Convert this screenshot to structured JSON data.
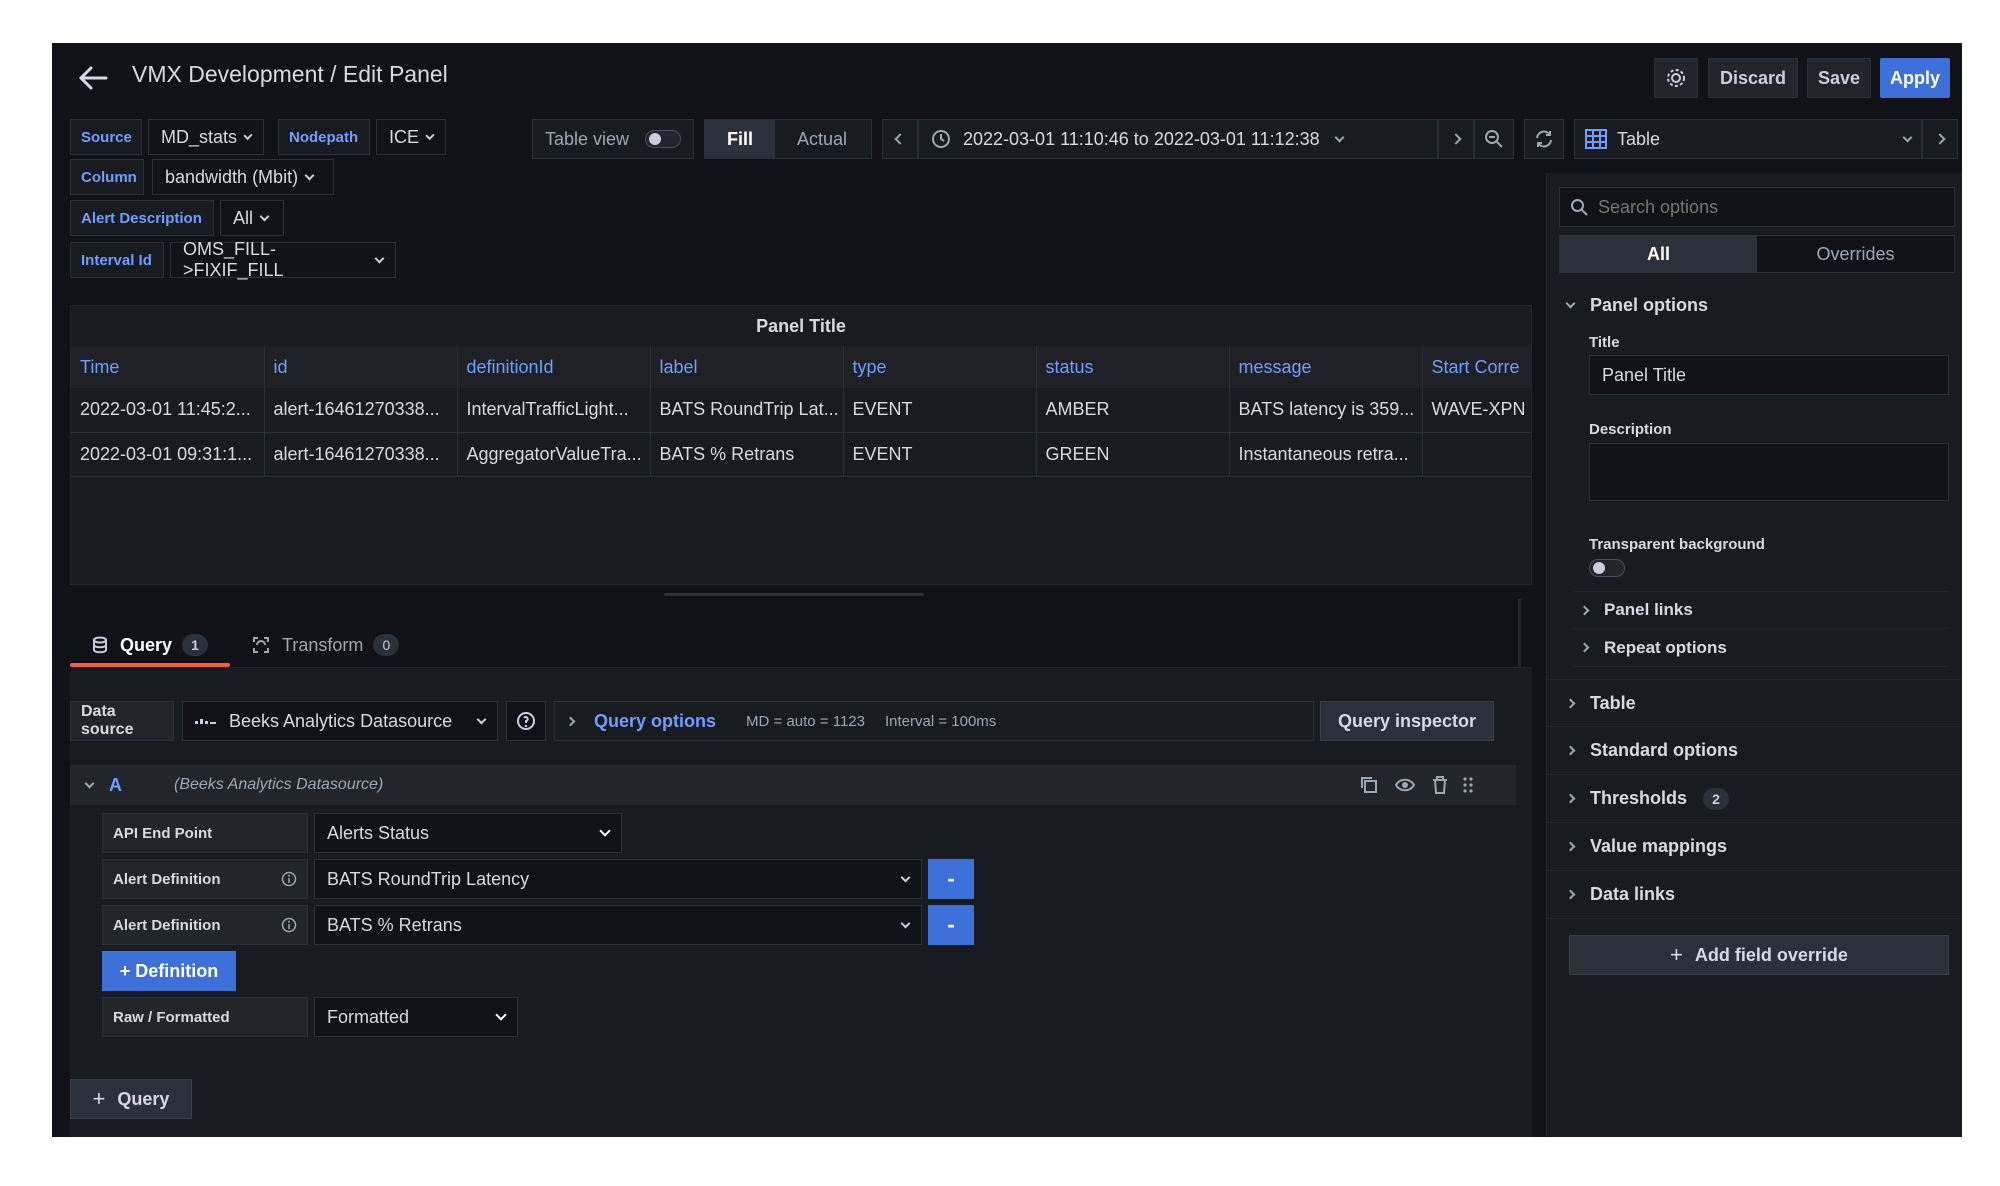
{
  "header": {
    "title": "VMX Development / Edit Panel",
    "discard": "Discard",
    "save": "Save",
    "apply": "Apply"
  },
  "variables": {
    "source_label": "Source",
    "source_value": "MD_stats",
    "nodepath_label": "Nodepath",
    "nodepath_value": "ICE",
    "column_label": "Column",
    "column_value": "bandwidth (Mbit)",
    "alert_desc_label": "Alert Description",
    "alert_desc_value": "All",
    "interval_label": "Interval Id",
    "interval_value": "OMS_FILL->FIXIF_FILL"
  },
  "toolbar": {
    "table_view": "Table view",
    "fill": "Fill",
    "actual": "Actual",
    "time_range": "2022-03-01 11:10:46 to 2022-03-01 11:12:38"
  },
  "viz": {
    "name": "Table"
  },
  "panel": {
    "title": "Panel Title",
    "columns": [
      "Time",
      "id",
      "definitionId",
      "label",
      "type",
      "status",
      "message",
      "Start Corre"
    ],
    "rows": [
      [
        "2022-03-01 11:45:2...",
        "alert-16461270338...",
        "IntervalTrafficLight...",
        "BATS RoundTrip Lat...",
        "EVENT",
        "AMBER",
        "BATS latency is 359...",
        "WAVE-XPN"
      ],
      [
        "2022-03-01 09:31:1...",
        "alert-16461270338...",
        "AggregatorValueTra...",
        "BATS % Retrans",
        "EVENT",
        "GREEN",
        "Instantaneous retra...",
        ""
      ]
    ]
  },
  "tabs": {
    "query": "Query",
    "query_count": "1",
    "transform": "Transform",
    "transform_count": "0"
  },
  "query": {
    "datasource_label": "Data source",
    "datasource_value": "Beeks Analytics Datasource",
    "options_label": "Query options",
    "md": "MD = auto = 1123",
    "interval": "Interval = 100ms",
    "inspector": "Query inspector",
    "ref_id": "A",
    "ref_ds": "(Beeks Analytics Datasource)",
    "api_label": "API End Point",
    "api_value": "Alerts Status",
    "alert_def_label": "Alert Definition",
    "alert_def_1": "BATS RoundTrip Latency",
    "alert_def_2": "BATS % Retrans",
    "minus": "-",
    "add_definition": "+ Definition",
    "raw_label": "Raw / Formatted",
    "raw_value": "Formatted",
    "add_query": "Query"
  },
  "options": {
    "search_placeholder": "Search options",
    "tab_all": "All",
    "tab_overrides": "Overrides",
    "panel_options": "Panel options",
    "title_label": "Title",
    "title_value": "Panel Title",
    "description_label": "Description",
    "transparent_label": "Transparent background",
    "panel_links": "Panel links",
    "repeat_options": "Repeat options",
    "table": "Table",
    "standard_options": "Standard options",
    "thresholds": "Thresholds",
    "thresholds_count": "2",
    "value_mappings": "Value mappings",
    "data_links": "Data links",
    "add_override": "Add field override"
  }
}
